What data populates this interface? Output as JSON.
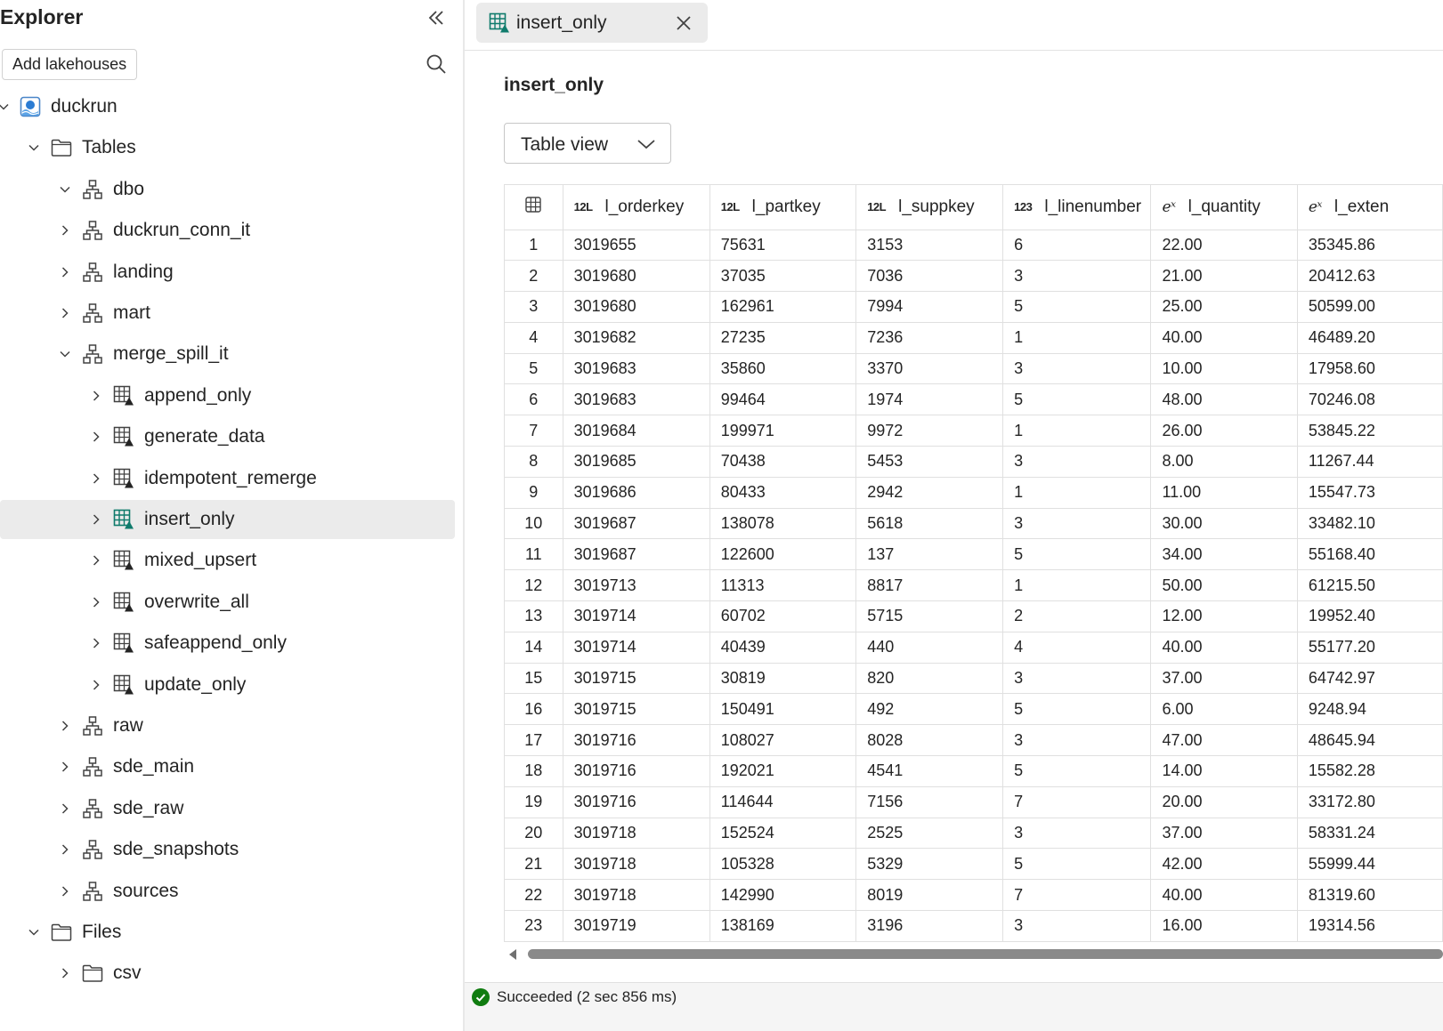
{
  "explorer": {
    "title": "Explorer",
    "add_button": "Add lakehouses",
    "icons": {
      "collapse": "double-chevron-left-icon",
      "search": "search-icon"
    },
    "tree": [
      {
        "label": "duckrun",
        "level": 0,
        "expanded": true,
        "kind": "lakehouse"
      },
      {
        "label": "Tables",
        "level": 1,
        "expanded": true,
        "kind": "folder"
      },
      {
        "label": "dbo",
        "level": 2,
        "expanded": true,
        "kind": "schema"
      },
      {
        "label": "duckrun_conn_it",
        "level": 2,
        "expanded": false,
        "kind": "schema"
      },
      {
        "label": "landing",
        "level": 2,
        "expanded": false,
        "kind": "schema"
      },
      {
        "label": "mart",
        "level": 2,
        "expanded": false,
        "kind": "schema"
      },
      {
        "label": "merge_spill_it",
        "level": 2,
        "expanded": true,
        "kind": "schema"
      },
      {
        "label": "append_only",
        "level": 3,
        "expanded": false,
        "kind": "table"
      },
      {
        "label": "generate_data",
        "level": 3,
        "expanded": false,
        "kind": "table"
      },
      {
        "label": "idempotent_remerge",
        "level": 3,
        "expanded": false,
        "kind": "table"
      },
      {
        "label": "insert_only",
        "level": 3,
        "expanded": false,
        "kind": "table-active",
        "selected": true
      },
      {
        "label": "mixed_upsert",
        "level": 3,
        "expanded": false,
        "kind": "table"
      },
      {
        "label": "overwrite_all",
        "level": 3,
        "expanded": false,
        "kind": "table"
      },
      {
        "label": "safeappend_only",
        "level": 3,
        "expanded": false,
        "kind": "table"
      },
      {
        "label": "update_only",
        "level": 3,
        "expanded": false,
        "kind": "table"
      },
      {
        "label": "raw",
        "level": 2,
        "expanded": false,
        "kind": "schema"
      },
      {
        "label": "sde_main",
        "level": 2,
        "expanded": false,
        "kind": "schema"
      },
      {
        "label": "sde_raw",
        "level": 2,
        "expanded": false,
        "kind": "schema"
      },
      {
        "label": "sde_snapshots",
        "level": 2,
        "expanded": false,
        "kind": "schema"
      },
      {
        "label": "sources",
        "level": 2,
        "expanded": false,
        "kind": "schema"
      },
      {
        "label": "Files",
        "level": 1,
        "expanded": true,
        "kind": "folder"
      },
      {
        "label": "csv",
        "level": 2,
        "expanded": false,
        "kind": "folder"
      }
    ]
  },
  "tab": {
    "label": "insert_only",
    "icon": "table-icon",
    "close_icon": "close-icon"
  },
  "page": {
    "title": "insert_only"
  },
  "view_select": {
    "value": "Table view",
    "icon": "chevron-down-icon"
  },
  "grid": {
    "columns": [
      {
        "type": "12L",
        "name": "l_orderkey"
      },
      {
        "type": "12L",
        "name": "l_partkey"
      },
      {
        "type": "12L",
        "name": "l_suppkey"
      },
      {
        "type": "123",
        "name": "l_linenumber"
      },
      {
        "type": "eˣ",
        "name": "l_quantity"
      },
      {
        "type": "eˣ",
        "name": "l_exten"
      }
    ],
    "rows": [
      [
        "1",
        "3019655",
        "75631",
        "3153",
        "6",
        "22.00",
        "35345.86"
      ],
      [
        "2",
        "3019680",
        "37035",
        "7036",
        "3",
        "21.00",
        "20412.63"
      ],
      [
        "3",
        "3019680",
        "162961",
        "7994",
        "5",
        "25.00",
        "50599.00"
      ],
      [
        "4",
        "3019682",
        "27235",
        "7236",
        "1",
        "40.00",
        "46489.20"
      ],
      [
        "5",
        "3019683",
        "35860",
        "3370",
        "3",
        "10.00",
        "17958.60"
      ],
      [
        "6",
        "3019683",
        "99464",
        "1974",
        "5",
        "48.00",
        "70246.08"
      ],
      [
        "7",
        "3019684",
        "199971",
        "9972",
        "1",
        "26.00",
        "53845.22"
      ],
      [
        "8",
        "3019685",
        "70438",
        "5453",
        "3",
        "8.00",
        "11267.44"
      ],
      [
        "9",
        "3019686",
        "80433",
        "2942",
        "1",
        "11.00",
        "15547.73"
      ],
      [
        "10",
        "3019687",
        "138078",
        "5618",
        "3",
        "30.00",
        "33482.10"
      ],
      [
        "11",
        "3019687",
        "122600",
        "137",
        "5",
        "34.00",
        "55168.40"
      ],
      [
        "12",
        "3019713",
        "11313",
        "8817",
        "1",
        "50.00",
        "61215.50"
      ],
      [
        "13",
        "3019714",
        "60702",
        "5715",
        "2",
        "12.00",
        "19952.40"
      ],
      [
        "14",
        "3019714",
        "40439",
        "440",
        "4",
        "40.00",
        "55177.20"
      ],
      [
        "15",
        "3019715",
        "30819",
        "820",
        "3",
        "37.00",
        "64742.97"
      ],
      [
        "16",
        "3019715",
        "150491",
        "492",
        "5",
        "6.00",
        "9248.94"
      ],
      [
        "17",
        "3019716",
        "108027",
        "8028",
        "3",
        "47.00",
        "48645.94"
      ],
      [
        "18",
        "3019716",
        "192021",
        "4541",
        "5",
        "14.00",
        "15582.28"
      ],
      [
        "19",
        "3019716",
        "114644",
        "7156",
        "7",
        "20.00",
        "33172.80"
      ],
      [
        "20",
        "3019718",
        "152524",
        "2525",
        "3",
        "37.00",
        "58331.24"
      ],
      [
        "21",
        "3019718",
        "105328",
        "5329",
        "5",
        "42.00",
        "55999.44"
      ],
      [
        "22",
        "3019718",
        "142990",
        "8019",
        "7",
        "40.00",
        "81319.60"
      ],
      [
        "23",
        "3019719",
        "138169",
        "3196",
        "3",
        "16.00",
        "19314.56"
      ]
    ]
  },
  "status": {
    "text": "Succeeded (2 sec 856 ms)",
    "icon": "check-circle-icon",
    "color": "#107c10"
  },
  "colors": {
    "accent_teal": "#0f7b6c",
    "selected_bg": "#ebebeb"
  }
}
